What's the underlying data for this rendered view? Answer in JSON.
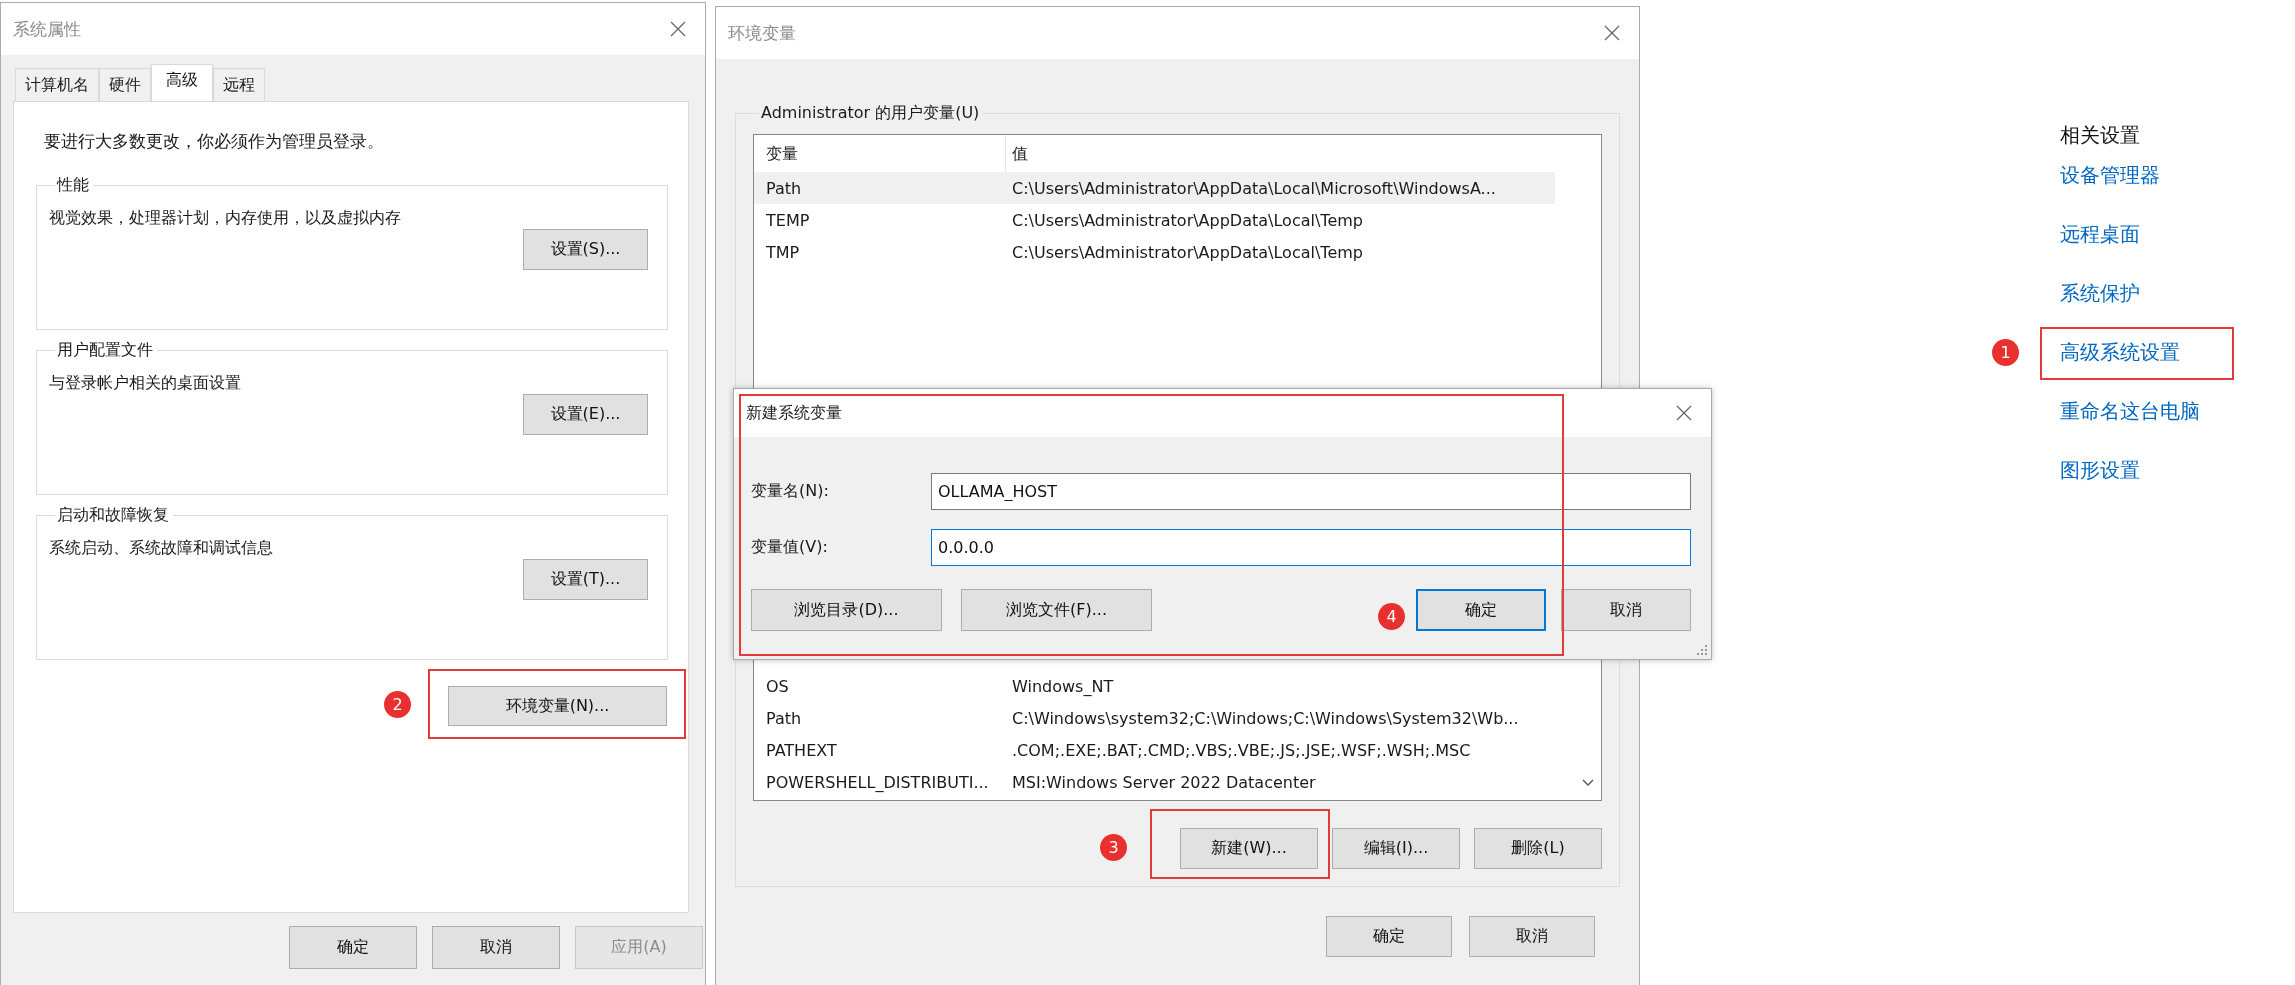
{
  "system_properties": {
    "title": "系统属性",
    "tabs": [
      {
        "label": "计算机名",
        "selected": false
      },
      {
        "label": "硬件",
        "selected": false
      },
      {
        "label": "高级",
        "selected": true
      },
      {
        "label": "远程",
        "selected": false
      }
    ],
    "notice": "要进行大多数更改，你必须作为管理员登录。",
    "groups": [
      {
        "title": "性能",
        "description": "视觉效果，处理器计划，内存使用，以及虚拟内存",
        "button": "设置(S)..."
      },
      {
        "title": "用户配置文件",
        "description": "与登录帐户相关的桌面设置",
        "button": "设置(E)..."
      },
      {
        "title": "启动和故障恢复",
        "description": "系统启动、系统故障和调试信息",
        "button": "设置(T)..."
      }
    ],
    "environment_button": {
      "label": "环境变量(N)...",
      "step": "2"
    },
    "buttons": [
      {
        "label": "确定",
        "disabled": false
      },
      {
        "label": "取消",
        "disabled": false
      },
      {
        "label": "应用(A)",
        "disabled": true
      }
    ]
  },
  "environment_variables": {
    "title": "环境变量",
    "user_group_title": "Administrator 的用户变量(U)",
    "columns": [
      "变量",
      "值"
    ],
    "user_variables": [
      {
        "name": "Path",
        "value": "C:\\Users\\Administrator\\AppData\\Local\\Microsoft\\WindowsA...",
        "selected": true
      },
      {
        "name": "TEMP",
        "value": "C:\\Users\\Administrator\\AppData\\Local\\Temp",
        "selected": false
      },
      {
        "name": "TMP",
        "value": "C:\\Users\\Administrator\\AppData\\Local\\Temp",
        "selected": false
      }
    ],
    "system_variables": [
      {
        "name": "OS",
        "value": "Windows_NT",
        "selected": false
      },
      {
        "name": "Path",
        "value": "C:\\Windows\\system32;C:\\Windows;C:\\Windows\\System32\\Wb...",
        "selected": false
      },
      {
        "name": "PATHEXT",
        "value": ".COM;.EXE;.BAT;.CMD;.VBS;.VBE;.JS;.JSE;.WSF;.WSH;.MSC",
        "selected": false
      },
      {
        "name": "POWERSHELL_DISTRIBUTI...",
        "value": "MSI:Windows Server 2022 Datacenter",
        "selected": false
      }
    ],
    "list_buttons": [
      {
        "label": "新建(W)...",
        "step": "3"
      },
      {
        "label": "编辑(I)..."
      },
      {
        "label": "删除(L)"
      }
    ],
    "buttons": [
      "确定",
      "取消"
    ]
  },
  "new_variable_dialog": {
    "title": "新建系统变量",
    "step": "4",
    "fields": [
      {
        "label": "变量名(N):",
        "value": "OLLAMA_HOST",
        "focused": false
      },
      {
        "label": "变量值(V):",
        "value": "0.0.0.0",
        "focused": true
      }
    ],
    "browse_buttons": [
      "浏览目录(D)...",
      "浏览文件(F)..."
    ],
    "buttons": [
      {
        "label": "确定",
        "default": true
      },
      {
        "label": "取消",
        "default": false
      }
    ]
  },
  "related_settings": {
    "title": "相关设置",
    "links": [
      {
        "label": "设备管理器"
      },
      {
        "label": "远程桌面"
      },
      {
        "label": "系统保护"
      },
      {
        "label": "高级系统设置",
        "step": "1"
      },
      {
        "label": "重命名这台电脑"
      },
      {
        "label": "图形设置"
      }
    ]
  }
}
